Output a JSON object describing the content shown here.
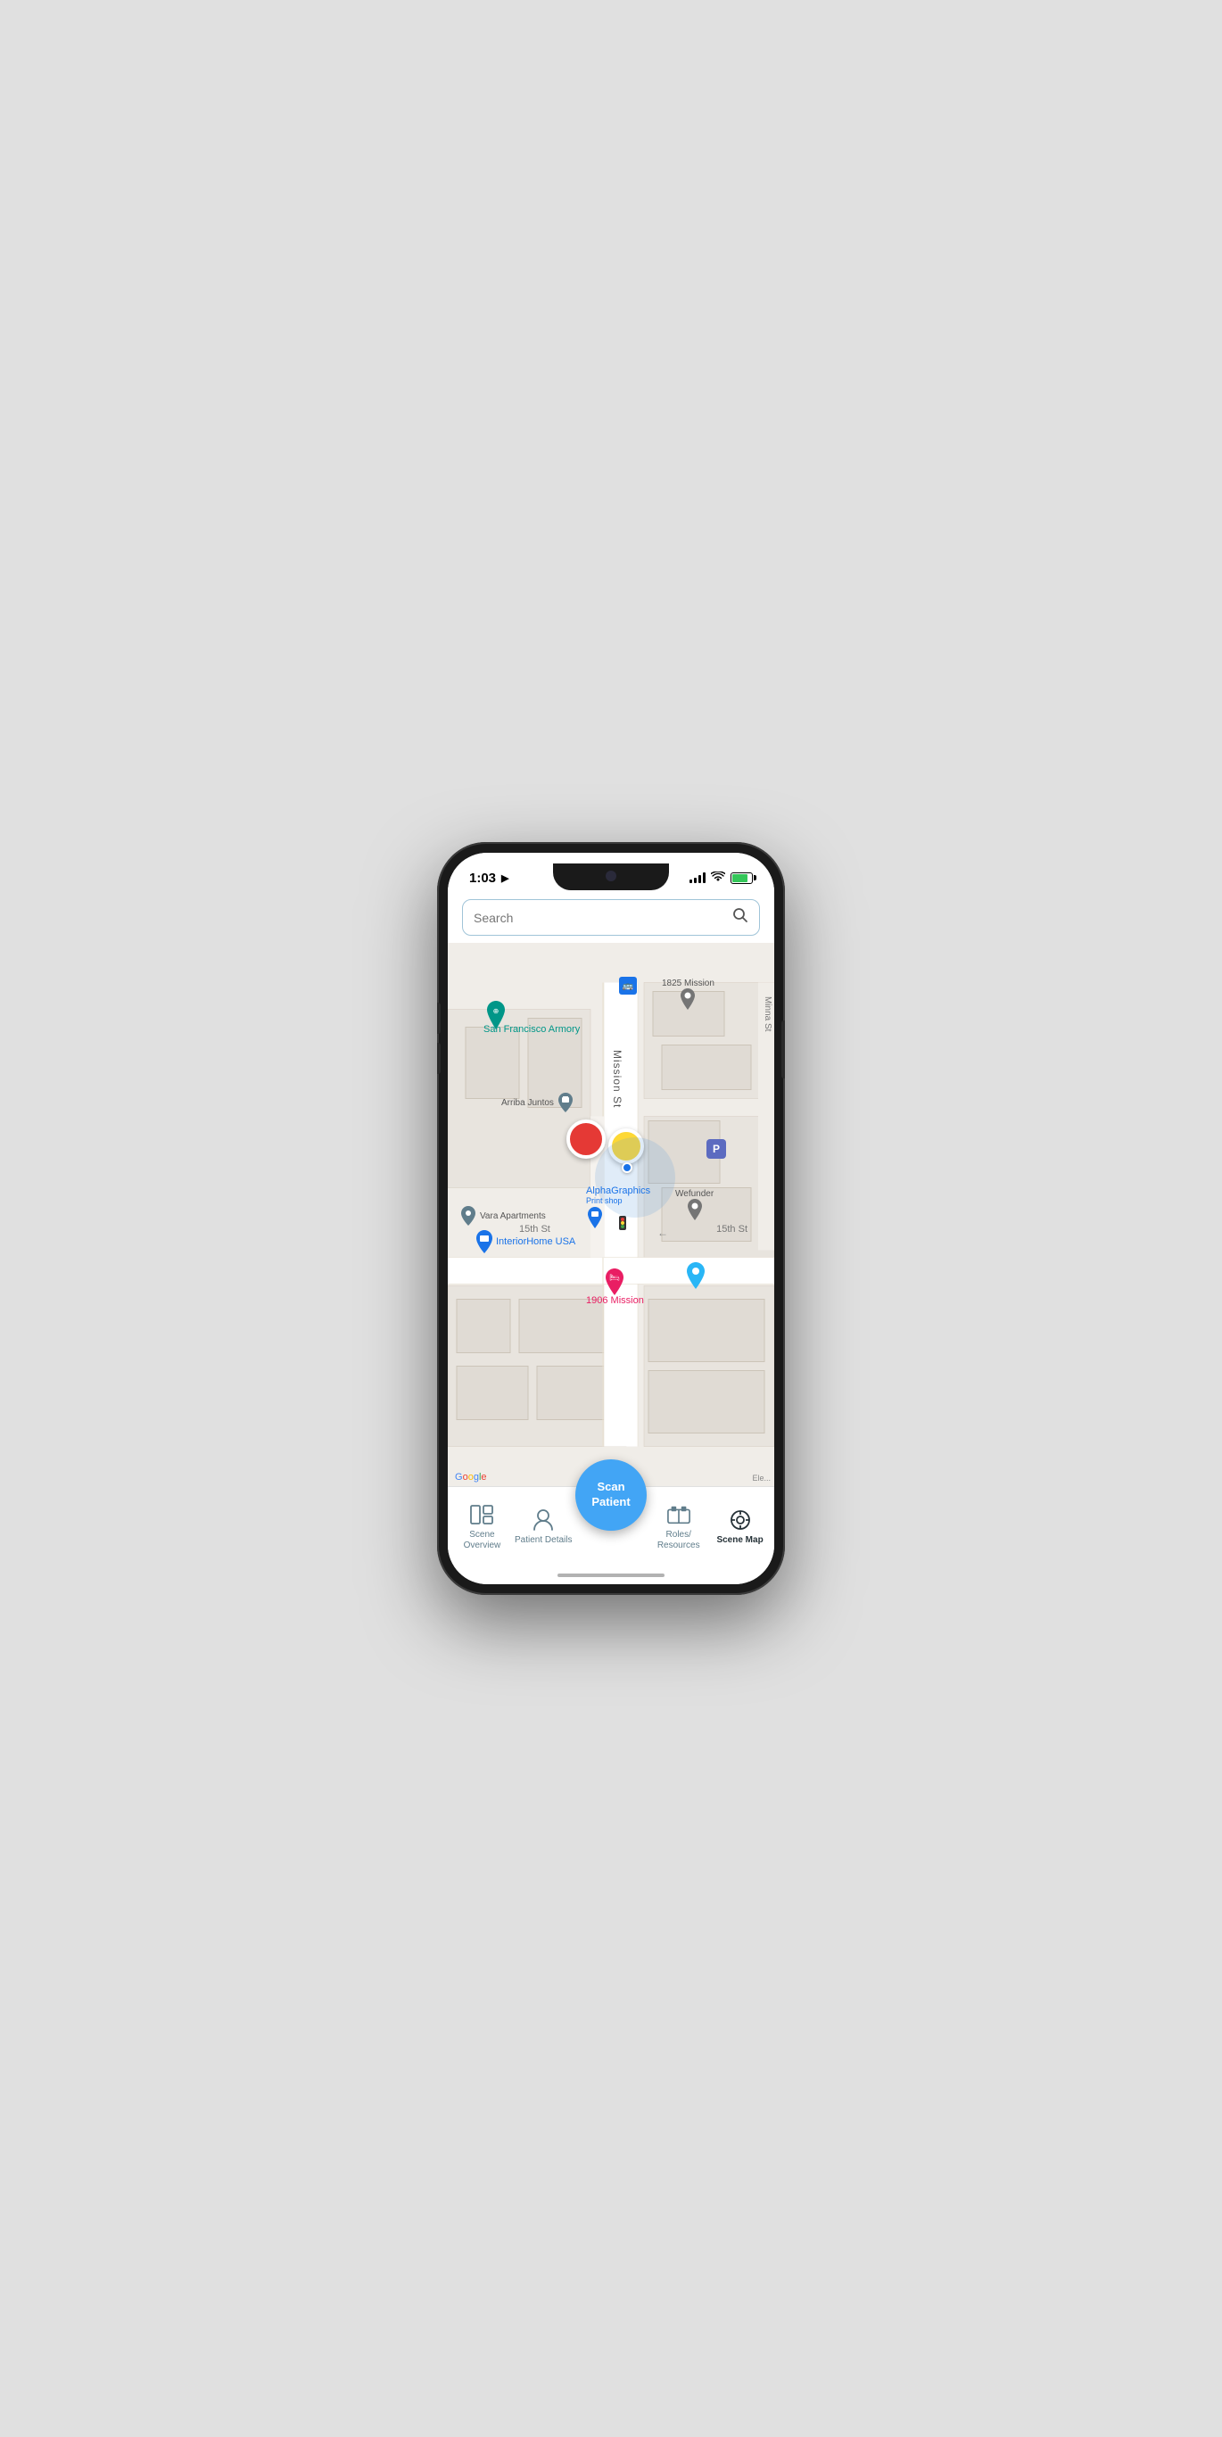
{
  "status_bar": {
    "time": "1:03",
    "location_arrow": "▶"
  },
  "search": {
    "placeholder": "Search"
  },
  "map": {
    "places": [
      {
        "name": "San Francisco Armory",
        "type": "teal"
      },
      {
        "name": "1825 Mission",
        "type": "default"
      },
      {
        "name": "Arriba Juntos",
        "type": "default"
      },
      {
        "name": "AlphaGraphics",
        "type": "blue"
      },
      {
        "name": "Print shop",
        "type": "small-blue"
      },
      {
        "name": "Wefunder",
        "type": "default"
      },
      {
        "name": "Vara Apartments",
        "type": "default"
      },
      {
        "name": "InteriorHome USA",
        "type": "blue"
      },
      {
        "name": "1906 Mission",
        "type": "pink"
      },
      {
        "name": "15th St",
        "type": "street"
      },
      {
        "name": "Mission St",
        "type": "street-vertical"
      },
      {
        "name": "Minna St",
        "type": "street-vertical-small"
      }
    ],
    "streets": [
      "15th St",
      "Mission St",
      "Minna St"
    ]
  },
  "tab_bar": {
    "items": [
      {
        "id": "scene-overview",
        "label": "Scene\nOverview",
        "active": false
      },
      {
        "id": "patient-details",
        "label": "Patient\nDetails",
        "active": false
      },
      {
        "id": "scan-patient",
        "label": "Scan\nPatient",
        "active": false,
        "fab": true
      },
      {
        "id": "roles-resources",
        "label": "Roles/\nResources",
        "active": false
      },
      {
        "id": "scene-map",
        "label": "Scene Map",
        "active": true
      }
    ]
  },
  "fab": {
    "label_line1": "Scan",
    "label_line2": "Patient"
  },
  "colors": {
    "teal": "#009688",
    "blue": "#1a73e8",
    "red": "#e53935",
    "yellow": "#fdd835",
    "fab_blue": "#42a5f5",
    "tab_active": "#263238",
    "tab_inactive": "#607d8b",
    "search_border": "#a0c4d8"
  }
}
